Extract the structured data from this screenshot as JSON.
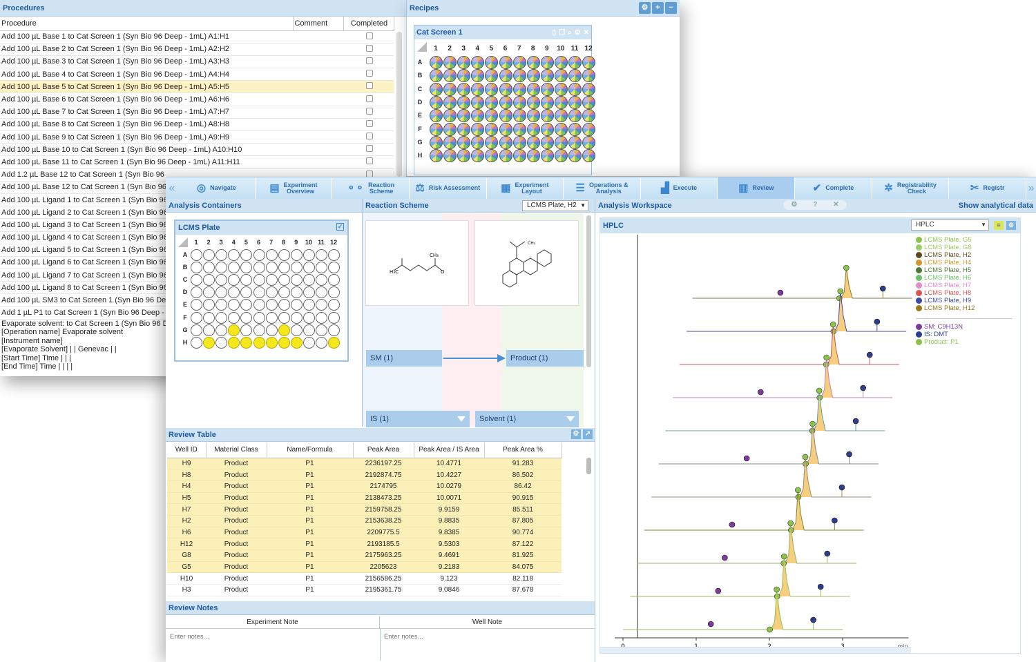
{
  "procedures": {
    "title": "Procedures",
    "columns": [
      "Procedure",
      "Comment",
      "Completed"
    ],
    "rows": [
      "Add 100 µL Base 1 to Cat Screen 1 (Syn Bio 96 Deep - 1mL) A1:H1",
      "Add 100 µL Base 2 to Cat Screen 1 (Syn Bio 96 Deep - 1mL) A2:H2",
      "Add 100 µL Base 3 to Cat Screen 1 (Syn Bio 96 Deep - 1mL) A3:H3",
      "Add 100 µL Base 4 to Cat Screen 1 (Syn Bio 96 Deep - 1mL) A4:H4",
      "Add 100 µL Base 5 to Cat Screen 1 (Syn Bio 96 Deep - 1mL) A5:H5",
      "Add 100 µL Base 6 to Cat Screen 1 (Syn Bio 96 Deep - 1mL) A6:H6",
      "Add 100 µL Base 7 to Cat Screen 1 (Syn Bio 96 Deep - 1mL) A7:H7",
      "Add 100 µL Base 8 to Cat Screen 1 (Syn Bio 96 Deep - 1mL) A8:H8",
      "Add 100 µL Base 9 to Cat Screen 1 (Syn Bio 96 Deep - 1mL) A9:H9",
      "Add 100 µL Base 10 to Cat Screen 1 (Syn Bio 96 Deep - 1mL) A10:H10",
      "Add 100 µL Base 11 to Cat Screen 1 (Syn Bio 96 Deep - 1mL) A11:H11",
      "Add 1.2 µL Base 12 to Cat Screen 1 (Syn Bio 96",
      "Add 100 µL Base 12 to Cat Screen 1 (Syn Bio 96",
      "Add 100 µL Ligand 1 to Cat Screen 1 (Syn Bio 96",
      "Add 100 µL Ligand 2 to Cat Screen 1 (Syn Bio 96",
      "Add 100 µL Ligand 3 to Cat Screen 1 (Syn Bio 96",
      "Add 100 µL Ligand 4 to Cat Screen 1 (Syn Bio 96",
      "Add 100 µL Ligand 5 to Cat Screen 1 (Syn Bio 96",
      "Add 100 µL Ligand 6 to Cat Screen 1 (Syn Bio 96",
      "Add 100 µL Ligand 7 to Cat Screen 1 (Syn Bio 96",
      "Add 100 µL Ligand 8 to Cat Screen 1 (Syn Bio 96",
      "Add 100 µL SM3 to Cat Screen 1 (Syn Bio 96 Dee",
      "Add 1 µL P1 to Cat Screen 1 (Syn Bio 96 Deep -"
    ],
    "tail": [
      "Evaporate solvent: to Cat Screen 1 (Syn Bio 96 D",
      "[Operation name] Evaporate solvent",
      "[Instrument name]",
      "[Evaporate Solvent] | | Genevac | |",
      "[Start Time] Time | |  |",
      "[End Time] Time | | | |"
    ]
  },
  "recipes": {
    "title": "Recipes",
    "plate_title": "Cat Screen 1",
    "cols": [
      "1",
      "2",
      "3",
      "4",
      "5",
      "6",
      "7",
      "8",
      "9",
      "10",
      "11",
      "12"
    ],
    "rows": [
      "A",
      "B",
      "C",
      "D",
      "E",
      "F",
      "G",
      "H"
    ]
  },
  "nav": [
    {
      "label": "Navigate",
      "icon": "◎"
    },
    {
      "label": "Experiment\nOverview",
      "icon": "▤"
    },
    {
      "label": "Reaction\nScheme",
      "icon": "⚬⚬"
    },
    {
      "label": "Risk Assessment",
      "icon": "⚖"
    },
    {
      "label": "Experiment\nLayout",
      "icon": "▦"
    },
    {
      "label": "Operations &\nAnalysis",
      "icon": "☰"
    },
    {
      "label": "Execute",
      "icon": "▟"
    },
    {
      "label": "Review",
      "icon": "▥"
    },
    {
      "label": "Complete",
      "icon": "✔"
    },
    {
      "label": "Registrability\nCheck",
      "icon": "✲"
    },
    {
      "label": "Registr",
      "icon": "✂"
    }
  ],
  "analysis_containers": {
    "title": "Analysis Containers",
    "plate_title": "LCMS Plate",
    "filled": {
      "G": [
        "4",
        "8"
      ],
      "H": [
        "2",
        "4",
        "5",
        "6",
        "7",
        "8",
        "9",
        "12"
      ]
    }
  },
  "reaction_scheme": {
    "title": "Reaction Scheme",
    "select": "LCMS Plate, H2",
    "sm": "SM (1)",
    "product": "Product (1)",
    "is": "IS (1)",
    "solvent": "Solvent (1)"
  },
  "review_table": {
    "title": "Review Table",
    "columns": [
      "Well ID",
      "Material Class",
      "Name/Formula",
      "Peak Area",
      "Peak Area / IS Area",
      "Peak Area %"
    ],
    "rows": [
      [
        "H9",
        "Product",
        "P1",
        "2236197.25",
        "10.4771",
        "91.283"
      ],
      [
        "H8",
        "Product",
        "P1",
        "2192874.75",
        "10.4227",
        "86.502"
      ],
      [
        "H4",
        "Product",
        "P1",
        "2174795",
        "10.0279",
        "86.42"
      ],
      [
        "H5",
        "Product",
        "P1",
        "2138473.25",
        "10.0071",
        "90.915"
      ],
      [
        "H7",
        "Product",
        "P1",
        "2159758.25",
        "9.9159",
        "85.511"
      ],
      [
        "H2",
        "Product",
        "P1",
        "2153638.25",
        "9.8835",
        "87.805"
      ],
      [
        "H6",
        "Product",
        "P1",
        "2209775.5",
        "9.8385",
        "90.774"
      ],
      [
        "H12",
        "Product",
        "P1",
        "2193185.5",
        "9.5303",
        "87.122"
      ],
      [
        "G8",
        "Product",
        "P1",
        "2175963.25",
        "9.4691",
        "81.925"
      ],
      [
        "G5",
        "Product",
        "P1",
        "2205623",
        "9.2183",
        "84.075"
      ],
      [
        "H10",
        "Product",
        "P1",
        "2156586.25",
        "9.123",
        "82.118"
      ],
      [
        "H3",
        "Product",
        "P1",
        "2195361.75",
        "9.0846",
        "87.678"
      ]
    ],
    "highlighted_count": 10
  },
  "review_notes": {
    "title": "Review Notes",
    "experiment_note": "Experiment Note",
    "well_note": "Well Note",
    "placeholder": "Enter notes..."
  },
  "workspace": {
    "title": "Analysis Workspace",
    "show_link": "Show analytical data",
    "panel_title": "HPLC",
    "select": "HPLC",
    "legend": [
      {
        "label": "LCMS Plate, G5",
        "color": "#8bc34a"
      },
      {
        "label": "LCMS Plate, G8",
        "color": "#9ccc65"
      },
      {
        "label": "LCMS Plate, H2",
        "color": "#5b4a1e"
      },
      {
        "label": "LCMS Plate, H4",
        "color": "#d19a2a"
      },
      {
        "label": "LCMS Plate, H5",
        "color": "#4c7a34"
      },
      {
        "label": "LCMS Plate, H6",
        "color": "#6cc06a"
      },
      {
        "label": "LCMS Plate, H7",
        "color": "#e58bc5"
      },
      {
        "label": "LCMS Plate, H8",
        "color": "#d9534f"
      },
      {
        "label": "LCMS Plate, H9",
        "color": "#3c4aa0"
      },
      {
        "label": "LCMS Plate, H12",
        "color": "#9b7a1c"
      }
    ],
    "peak_legend": [
      {
        "label": "SM: C9H13N",
        "color": "#7d3c98"
      },
      {
        "label": "IS: DMT",
        "color": "#2c3e8c"
      },
      {
        "label": "Product: P1",
        "color": "#8bc34a"
      }
    ],
    "x_ticks": [
      "0",
      "1",
      "2",
      "3"
    ],
    "x_unit": "min"
  },
  "chart_data": {
    "type": "line",
    "title": "HPLC",
    "xlabel": "min",
    "xlim": [
      0,
      3.9
    ],
    "x_ticks": [
      0,
      1,
      2,
      3
    ],
    "series_offsets_min": [
      0.95,
      0.87,
      0.77,
      0.68,
      0.58,
      0.49,
      0.39,
      0.29,
      0.19,
      0.1,
      0
    ],
    "peaks": {
      "SM": {
        "rt": 1.2
      },
      "Product": {
        "rt": 2.1
      },
      "IS": {
        "rt": 2.6
      }
    }
  }
}
